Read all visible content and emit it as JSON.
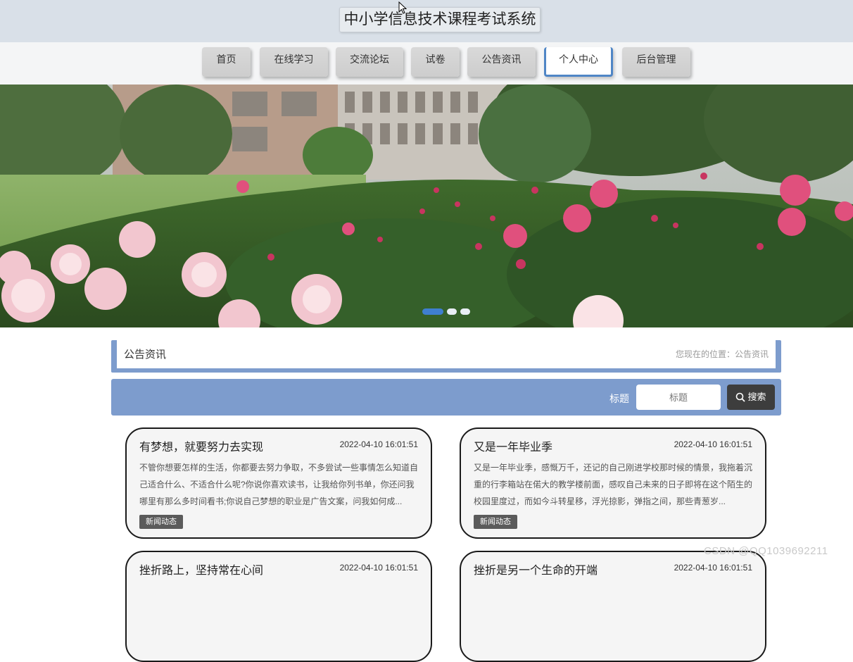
{
  "site": {
    "title": "中小学信息技术课程考试系统"
  },
  "nav": {
    "items": [
      {
        "label": "首页",
        "active": false
      },
      {
        "label": "在线学习",
        "active": false
      },
      {
        "label": "交流论坛",
        "active": false
      },
      {
        "label": "试卷",
        "active": false
      },
      {
        "label": "公告资讯",
        "active": false
      },
      {
        "label": "个人中心",
        "active": true
      },
      {
        "label": "后台管理",
        "active": false
      }
    ]
  },
  "banner": {
    "slides": 3,
    "active_slide": 1
  },
  "breadcrumb": {
    "title": "公告资讯",
    "location": "您现在的位置：公告资讯"
  },
  "search": {
    "label": "标题",
    "placeholder": "标题",
    "button": "搜索"
  },
  "cards": [
    {
      "title": "有梦想，就要努力去实现",
      "time": "2022-04-10 16:01:51",
      "body": "不管你想要怎样的生活，你都要去努力争取，不多尝试一些事情怎么知道自己适合什么、不适合什么呢?你说你喜欢读书，让我给你列书单，你还问我哪里有那么多时间看书;你说自己梦想的职业是广告文案，问我如何成...",
      "tag": "新闻动态"
    },
    {
      "title": "又是一年毕业季",
      "time": "2022-04-10 16:01:51",
      "body": "又是一年毕业季，感慨万千，还记的自己刚进学校那时候的情景，我拖着沉重的行李箱站在偌大的教学楼前面，感叹自己未来的日子即将在这个陌生的校园里度过，而如今斗转星移，浮光掠影，弹指之间，那些青葱岁...",
      "tag": "新闻动态"
    },
    {
      "title": "挫折路上，坚持常在心间",
      "time": "2022-04-10 16:01:51",
      "body": "",
      "tag": ""
    },
    {
      "title": "挫折是另一个生命的开端",
      "time": "2022-04-10 16:01:51",
      "body": "",
      "tag": ""
    }
  ],
  "watermark": "CSDN @QQ1039692211",
  "colors": {
    "accent": "#7d9ccd",
    "nav_active_border": "#4f86c6",
    "header_bg": "#d9e0e8",
    "dark_button": "#3d3d3d"
  }
}
